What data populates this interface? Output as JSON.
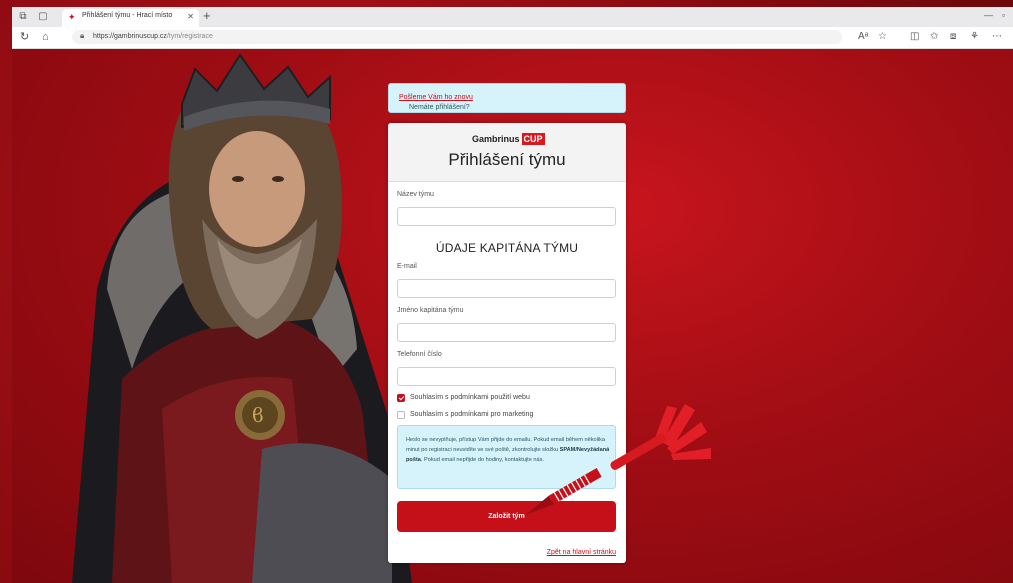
{
  "browser": {
    "tab_title": "Přihlášení týmu - Hrací místo",
    "url_host": "https://gambrinuscup.cz",
    "url_path": "/tym/registrace"
  },
  "notice": {
    "text": "Nemáte přihlášení?",
    "link": "Pošleme Vám ho znovu"
  },
  "form": {
    "logo_brand": "Gambrinus",
    "logo_cup": "CUP",
    "title": "Přihlášení týmu",
    "team_name_label": "Název týmu",
    "section_title": "ÚDAJE KAPITÁNA TÝMU",
    "email_label": "E-mail",
    "captain_name_label": "Jméno kapitána týmu",
    "phone_label": "Telefonní číslo",
    "terms_label": "Souhlasím s podmínkami použití webu",
    "marketing_label": "Souhlasím s podmínkami pro marketing",
    "info_part1": "Heslo se nevyplňuje, přístup Vám přijde do emailu. Pokud email během několika minut po registraci neuvidíte ve své poště, zkontrolujte složku ",
    "info_bold": "SPAM/Nevyžádaná pošta",
    "info_part2": ". Pokud email nepřijde do hodiny, kontaktujte nás.",
    "submit_label": "Založit tým",
    "back_link": "Zpět na hlavní stránku"
  },
  "state": {
    "terms_checked": true,
    "marketing_checked": false
  },
  "colors": {
    "accent": "#c5101a",
    "background": "#a10d14",
    "info_bg": "#d6f2fb"
  }
}
